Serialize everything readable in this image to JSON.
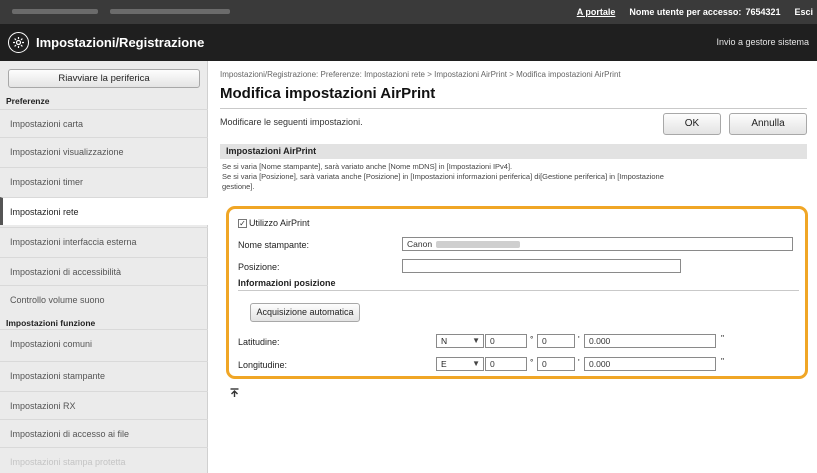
{
  "topbar": {
    "portal_link": "A portale",
    "username_label": "Nome utente per accesso:",
    "username_value": "7654321",
    "logout_link": "Esci"
  },
  "titlebar": {
    "title": "Impostazioni/Registrazione",
    "right_text": "Invio a gestore sistema"
  },
  "sidebar": {
    "restart_label": "Riavviare la periferica",
    "sections": [
      {
        "heading": "Preferenze",
        "items": [
          {
            "label": "Impostazioni carta"
          },
          {
            "label": "Impostazioni visualizzazione"
          },
          {
            "label": "Impostazioni timer"
          },
          {
            "label": "Impostazioni rete",
            "active": true
          },
          {
            "label": "Impostazioni interfaccia esterna"
          },
          {
            "label": "Impostazioni di accessibilità"
          },
          {
            "label": "Controllo volume suono"
          }
        ]
      },
      {
        "heading": "Impostazioni funzione",
        "items": [
          {
            "label": "Impostazioni comuni"
          },
          {
            "label": "Impostazioni stampante"
          },
          {
            "label": "Impostazioni RX"
          },
          {
            "label": "Impostazioni di accesso ai file"
          },
          {
            "label": "Impostazioni stampa protetta"
          }
        ]
      }
    ]
  },
  "main": {
    "breadcrumb": "Impostazioni/Registrazione: Preferenze: Impostazioni rete > Impostazioni AirPrint > Modifica impostazioni AirPrint",
    "page_title": "Modifica impostazioni AirPrint",
    "instruction": "Modificare le seguenti impostazioni.",
    "ok_label": "OK",
    "cancel_label": "Annulla",
    "section_title": "Impostazioni AirPrint",
    "note1": "Se si varia [Nome stampante], sarà variato anche [Nome mDNS] in [Impostazioni IPv4].",
    "note2": "Se si varia [Posizione], sarà variata anche [Posizione] in [Impostazioni informazioni periferica] di[Gestione periferica] in [Impostazione",
    "note3": "gestione].",
    "use_airprint_label": "Utilizzo AirPrint",
    "use_airprint_checked": true,
    "printer_name_label": "Nome stampante:",
    "printer_name_value": "Canon",
    "location_label": "Posizione:",
    "location_value": "",
    "location_info_heading": "Informazioni posizione",
    "auto_acquire_label": "Acquisizione automatica",
    "latitude": {
      "label": "Latitudine:",
      "hemisphere": "N",
      "degrees": "0",
      "minutes": "0",
      "seconds": "0.000"
    },
    "longitude": {
      "label": "Longitudine:",
      "hemisphere": "E",
      "degrees": "0",
      "minutes": "0",
      "seconds": "0.000"
    },
    "degree_symbol": "°",
    "minute_symbol": "'",
    "second_symbol": "\"",
    "to_top_icon": "arrow-to-top-icon"
  },
  "colors": {
    "highlight_frame": "#f0a626",
    "title_bar": "#1f1f1f",
    "top_bar": "#3a3a3a"
  }
}
